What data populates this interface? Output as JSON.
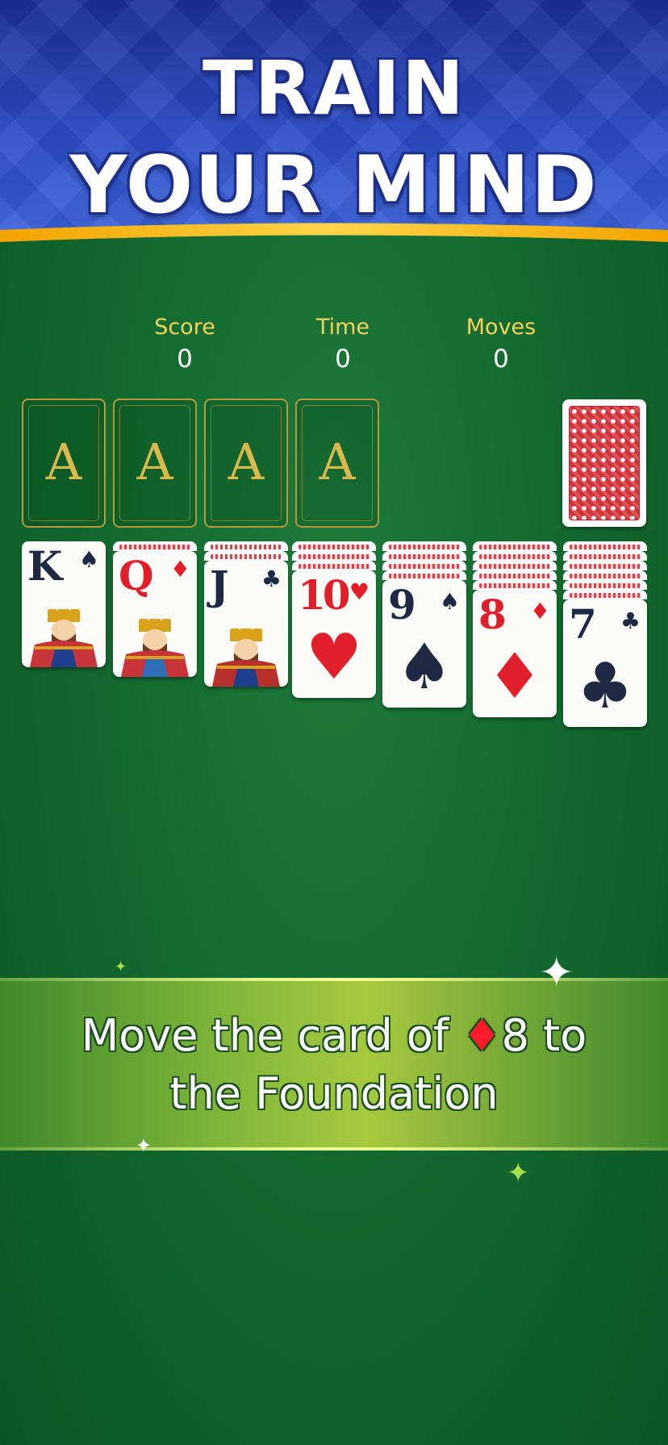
{
  "banner": {
    "line1": "TRAIN",
    "line2": "YOUR MIND"
  },
  "stats": {
    "score": {
      "label": "Score",
      "value": "0"
    },
    "time": {
      "label": "Time",
      "value": "0"
    },
    "moves": {
      "label": "Moves",
      "value": "0"
    }
  },
  "foundations": [
    "A",
    "A",
    "A",
    "A"
  ],
  "tableau": [
    {
      "rank": "K",
      "suit": "♠",
      "color": "black",
      "face": true,
      "hidden": 0
    },
    {
      "rank": "Q",
      "suit": "♦",
      "color": "red",
      "face": true,
      "hidden": 1
    },
    {
      "rank": "J",
      "suit": "♣",
      "color": "black",
      "face": true,
      "hidden": 2
    },
    {
      "rank": "10",
      "suit": "♥",
      "color": "red",
      "face": false,
      "hidden": 3
    },
    {
      "rank": "9",
      "suit": "♠",
      "color": "black",
      "face": false,
      "hidden": 4
    },
    {
      "rank": "8",
      "suit": "♦",
      "color": "red",
      "face": false,
      "hidden": 5
    },
    {
      "rank": "7",
      "suit": "♣",
      "color": "black",
      "face": false,
      "hidden": 6
    }
  ],
  "hint": {
    "before": "Move the card of ",
    "suit": "♦",
    "after": "8 to",
    "line2": "the Foundation"
  },
  "colors": {
    "felt": "#136a2f",
    "banner": "#2b4cc6",
    "label": "#f3d35a",
    "red": "#e01f2b",
    "black": "#1e2a44"
  }
}
